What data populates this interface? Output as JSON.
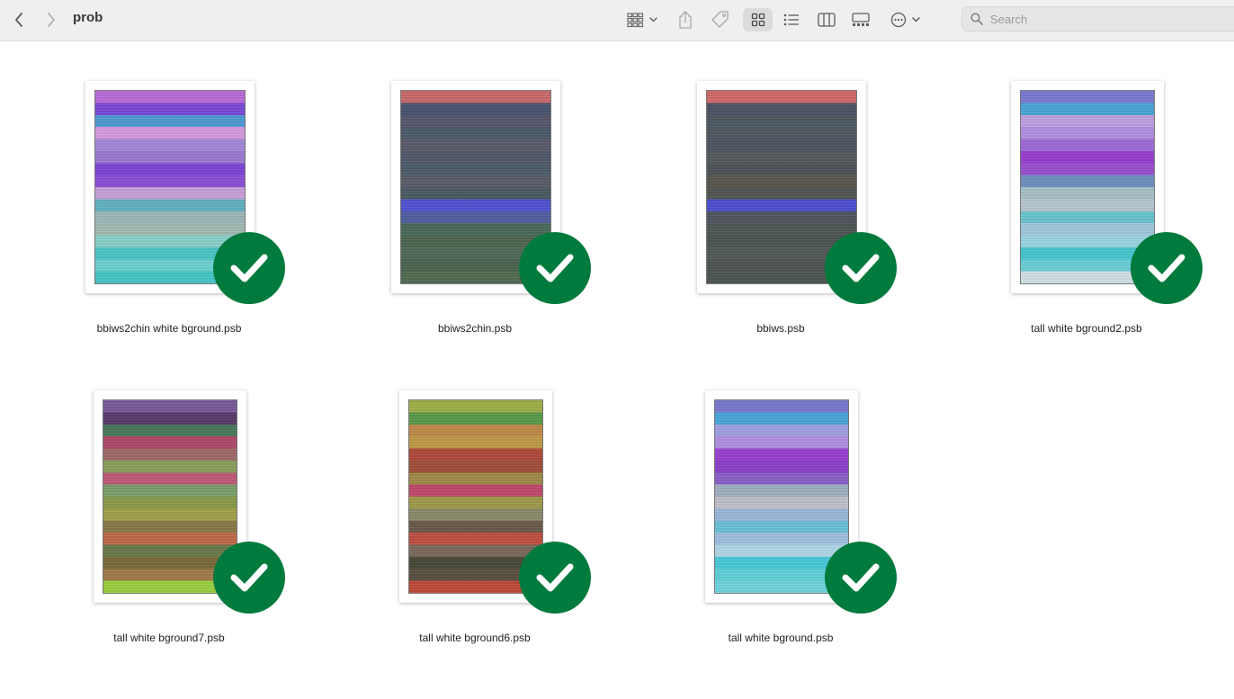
{
  "window": {
    "title": "prob"
  },
  "toolbar": {
    "back_icon": "chevron-left-icon",
    "forward_icon": "chevron-right-icon",
    "group_icon": "grid-group-icon",
    "share_icon": "share-icon",
    "tag_icon": "tag-icon",
    "icon_view_icon": "grid-icon",
    "list_view_icon": "list-icon",
    "column_view_icon": "columns-icon",
    "gallery_view_icon": "gallery-icon",
    "more_icon": "ellipsis-circle-icon"
  },
  "search": {
    "placeholder": "Search",
    "value": ""
  },
  "files": [
    {
      "name": "bbiws2chin white bground.psb",
      "synced": true,
      "stripes": [
        "#b96bd8",
        "#7a49d7",
        "#4e9ad3",
        "#d79ae0",
        "#a48ad8",
        "#9c7ad2",
        "#7d44d6",
        "#8d4fd8",
        "#c8a0d8",
        "#62b2c3",
        "#9cb8b8",
        "#a0bcb2",
        "#8ad0cb",
        "#4ac6c7",
        "#6ed2d0",
        "#46c6c6"
      ]
    },
    {
      "name": "bbiws2chin.psb",
      "synced": true,
      "stripes": [
        "#c86a6a",
        "#4a5470",
        "#56566e",
        "#4c5a6a",
        "#5a5a6a",
        "#50586a",
        "#4e5c6a",
        "#5a5c68",
        "#4c5a64",
        "#5252d0",
        "#5060a0",
        "#4a6a5a",
        "#4e6652",
        "#506a56",
        "#4c6450",
        "#526a52"
      ]
    },
    {
      "name": "bbiws.psb",
      "synced": true,
      "stripes": [
        "#d06a6a",
        "#4e5464",
        "#4e5862",
        "#525860",
        "#4e5660",
        "#555a5e",
        "#4e5458",
        "#5a584e",
        "#535652",
        "#4f4fd0",
        "#505460",
        "#4e5656",
        "#4c5454",
        "#525a58",
        "#4e5454",
        "#4e5652"
      ]
    },
    {
      "name": "tall white bground2.psb",
      "synced": true,
      "stripes": [
        "#7a7ad0",
        "#4aa6d8",
        "#c0a0e0",
        "#b090e0",
        "#a06ad8",
        "#9a3fd0",
        "#9a50d0",
        "#7090c0",
        "#a8c0c8",
        "#b8c8d0",
        "#6ac6d0",
        "#a0c8dc",
        "#9ad6e0",
        "#48c6d0",
        "#6ad0d6",
        "#d0e0e4"
      ]
    },
    {
      "name": "tall white bground7.psb",
      "synced": true,
      "stripes": [
        "#7a5a9a",
        "#5a3a6a",
        "#4a7a5a",
        "#b04a6a",
        "#a06a6a",
        "#8aa05a",
        "#c05a7a",
        "#7aa06a",
        "#8a9a4a",
        "#a0a04a",
        "#8a7a4a",
        "#c06a4a",
        "#6a7a4a",
        "#7a6a3a",
        "#a07a4a",
        "#9ad040"
      ]
    },
    {
      "name": "tall white bground6.psb",
      "synced": true,
      "stripes": [
        "#a0b04a",
        "#5a9a4a",
        "#c08a4a",
        "#c09a4a",
        "#b04a3a",
        "#a0503a",
        "#a08a4a",
        "#c04a6a",
        "#a09a4a",
        "#8a8a6a",
        "#6a5a4a",
        "#c05040",
        "#7a6a5a",
        "#4a4a3a",
        "#5a5040",
        "#c04a3a"
      ]
    },
    {
      "name": "tall white bground.psb",
      "synced": true,
      "stripes": [
        "#7a7ad0",
        "#4aa6d8",
        "#a0a0e0",
        "#b090e0",
        "#9a40d0",
        "#8a40c8",
        "#8a60c8",
        "#a0b0c0",
        "#c0c0c8",
        "#9ab8d8",
        "#6ac0d8",
        "#a0c0e0",
        "#b0d8e8",
        "#48c8d8",
        "#60d0d8",
        "#70d4dc"
      ]
    }
  ]
}
